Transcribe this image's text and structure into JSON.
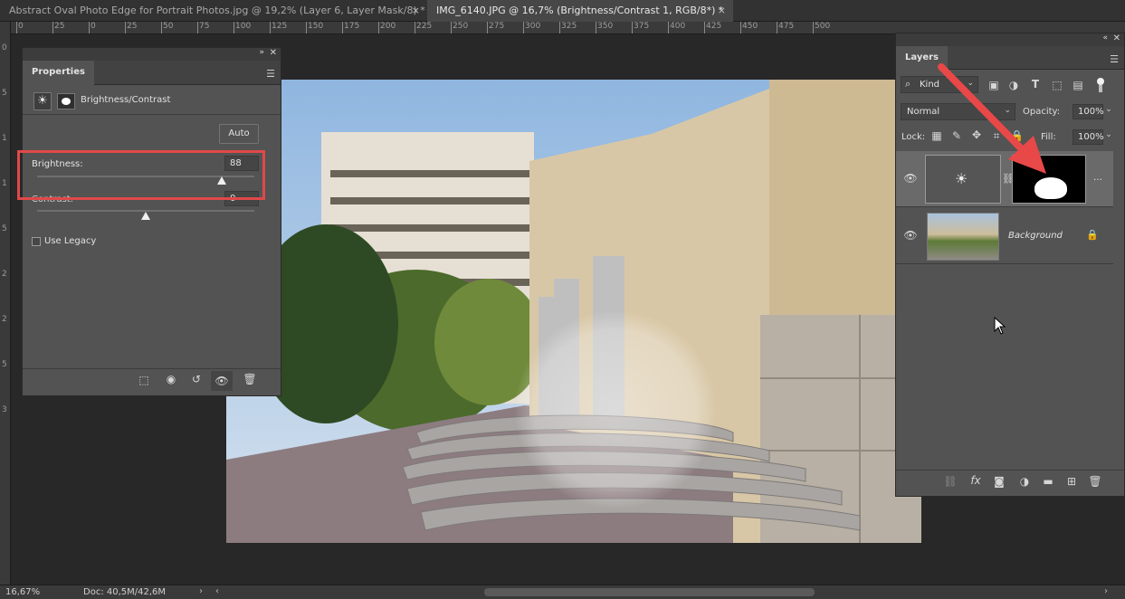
{
  "tabs": [
    {
      "label": "Abstract Oval Photo Edge for Portrait Photos.jpg @ 19,2% (Layer 6, Layer Mask/8) *",
      "active": false
    },
    {
      "label": "IMG_6140.JPG @ 16,7% (Brightness/Contrast 1, RGB/8*) *",
      "active": true
    }
  ],
  "tab_close": "×",
  "ruler": {
    "horizontal": [
      "0",
      "25",
      "0",
      "25",
      "50",
      "75",
      "100",
      "125",
      "150",
      "175",
      "200",
      "225",
      "250",
      "275",
      "300",
      "325",
      "350",
      "375",
      "400",
      "425",
      "450",
      "475",
      "500"
    ],
    "vertical": [
      "0",
      "5",
      "1",
      "1",
      "5",
      "2",
      "2",
      "5",
      "3"
    ]
  },
  "properties": {
    "tab_label": "Properties",
    "adjustment_name": "Brightness/Contrast",
    "auto_label": "Auto",
    "brightness_label": "Brightness:",
    "brightness_value": "88",
    "brightness_fraction": 0.85,
    "contrast_label": "Contrast:",
    "contrast_value": "0",
    "contrast_fraction": 0.5,
    "use_legacy_label": "Use Legacy"
  },
  "layers": {
    "tab_label": "Layers",
    "filter_kind": "Kind",
    "blend_mode": "Normal",
    "opacity_label": "Opacity:",
    "opacity_value": "100%",
    "lock_label": "Lock:",
    "fill_label": "Fill:",
    "fill_value": "100%",
    "items": [
      {
        "name": "",
        "type": "adjustment",
        "selected": true
      },
      {
        "name": "Background",
        "type": "image",
        "locked": true
      }
    ]
  },
  "status": {
    "zoom": "16,67%",
    "doc": "Doc: 40,5M/42,6M"
  },
  "colors": {
    "highlight_box": "#e04848",
    "arrow": "#e84848",
    "panel_bg": "#535353"
  }
}
